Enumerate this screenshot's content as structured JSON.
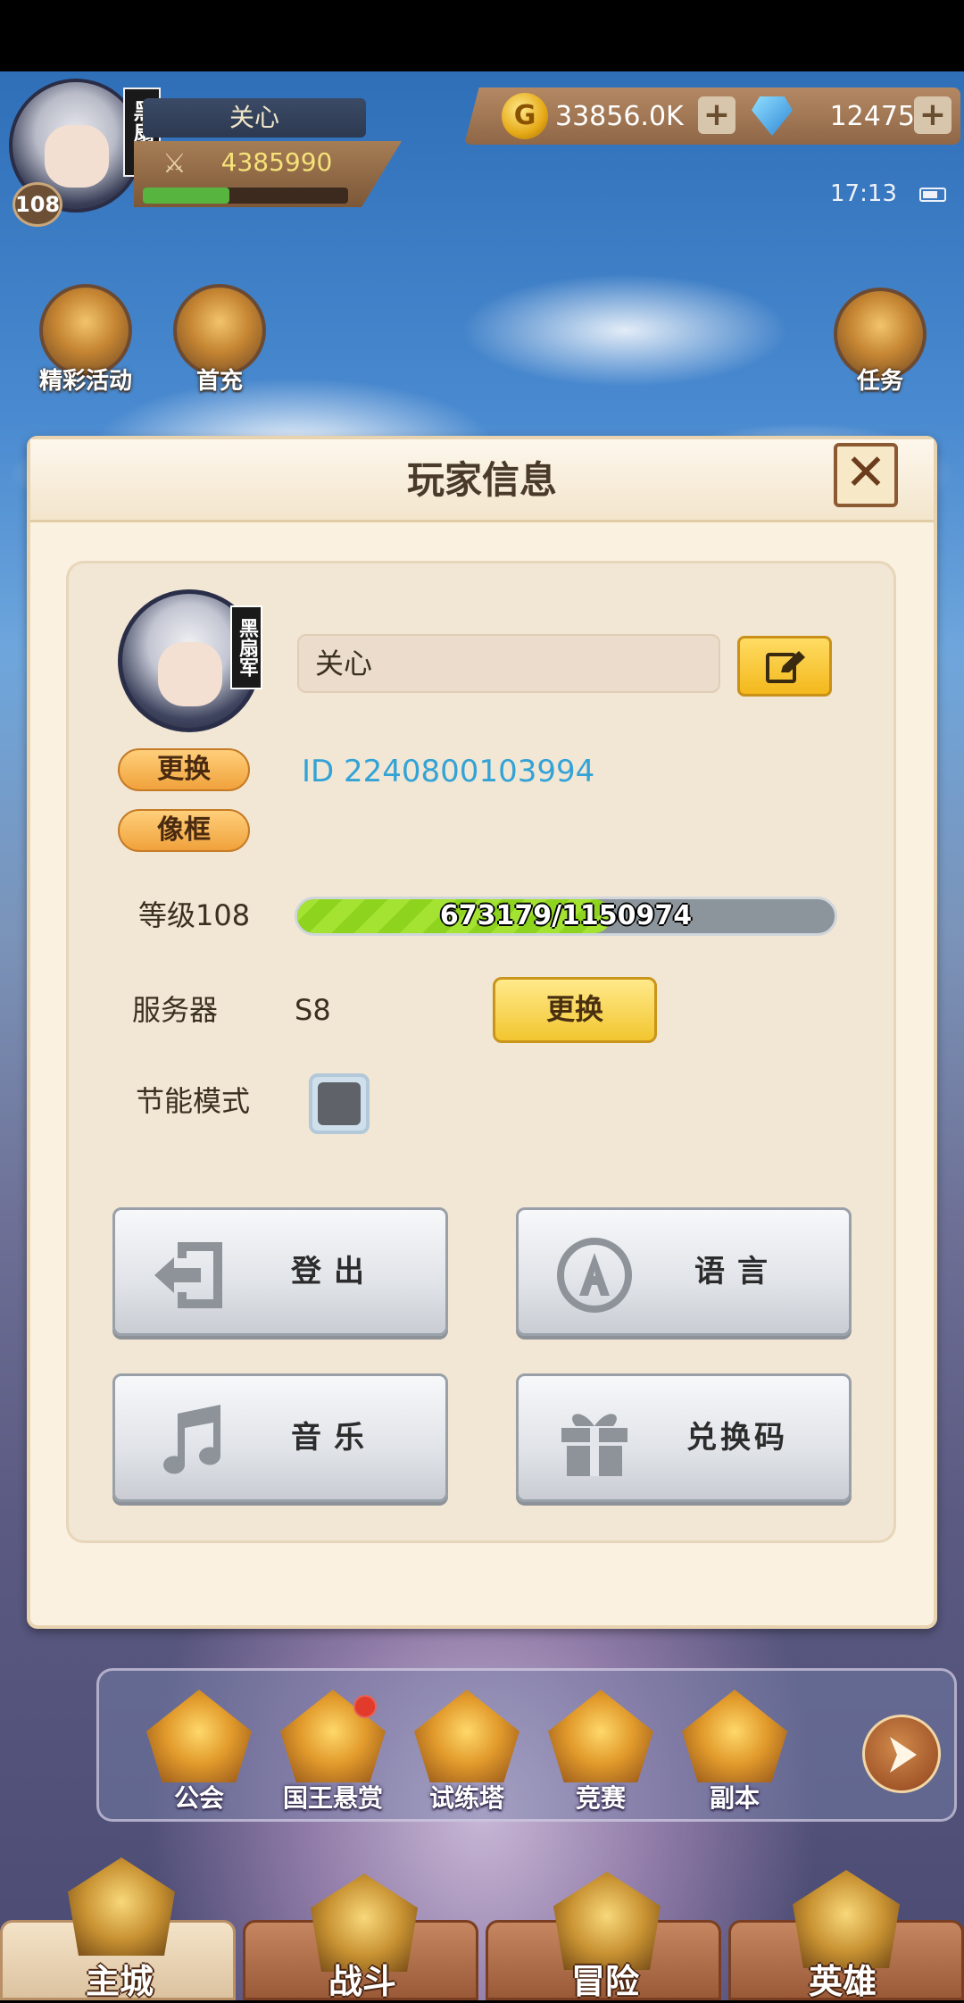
{
  "hud": {
    "player_name": "关心",
    "level": "108",
    "avatar_tag": "黑扇军",
    "power": "4385990",
    "exp_fraction": 0.42,
    "gold": "33856.0K",
    "gems": "12475",
    "time": "17:13"
  },
  "top_icons": [
    {
      "label": "精彩活动",
      "icon": "events-chest-icon"
    },
    {
      "label": "首充",
      "icon": "gift-box-icon"
    },
    {
      "label": "任务",
      "icon": "scroll-icon"
    }
  ],
  "dialog": {
    "title": "玩家信息",
    "avatar_tag": "黑扇军",
    "change_avatar": "更换",
    "frame": "像框",
    "name_value": "关心",
    "id_text": "ID 2240800103994",
    "level_label": "等级108",
    "exp_text": "673179/1150974",
    "exp_fraction": 0.5848,
    "server_label": "服务器",
    "server_value": "S8",
    "server_change": "更换",
    "eco_label": "节能模式",
    "eco_checked": false,
    "buttons": {
      "logout": "登出",
      "language": "语言",
      "music": "音乐",
      "redeem": "兑换码"
    }
  },
  "shortcuts": [
    {
      "label": "公会",
      "icon": "guild-shield-icon"
    },
    {
      "label": "国王悬赏",
      "icon": "crown-icon",
      "badge": true
    },
    {
      "label": "试练塔",
      "icon": "tower-gem-icon"
    },
    {
      "label": "竞赛",
      "icon": "crossed-swords-icon"
    },
    {
      "label": "副本",
      "icon": "cauldron-icon"
    }
  ],
  "nav": {
    "tabs": [
      {
        "label": "主城",
        "active": true
      },
      {
        "label": "战斗",
        "active": false
      },
      {
        "label": "冒险",
        "active": false
      },
      {
        "label": "英雄",
        "active": false
      }
    ]
  },
  "colors": {
    "accent_blue": "#33a3d6",
    "exp_green": "#a4e332",
    "dialog_bg": "#fbf1e0"
  }
}
